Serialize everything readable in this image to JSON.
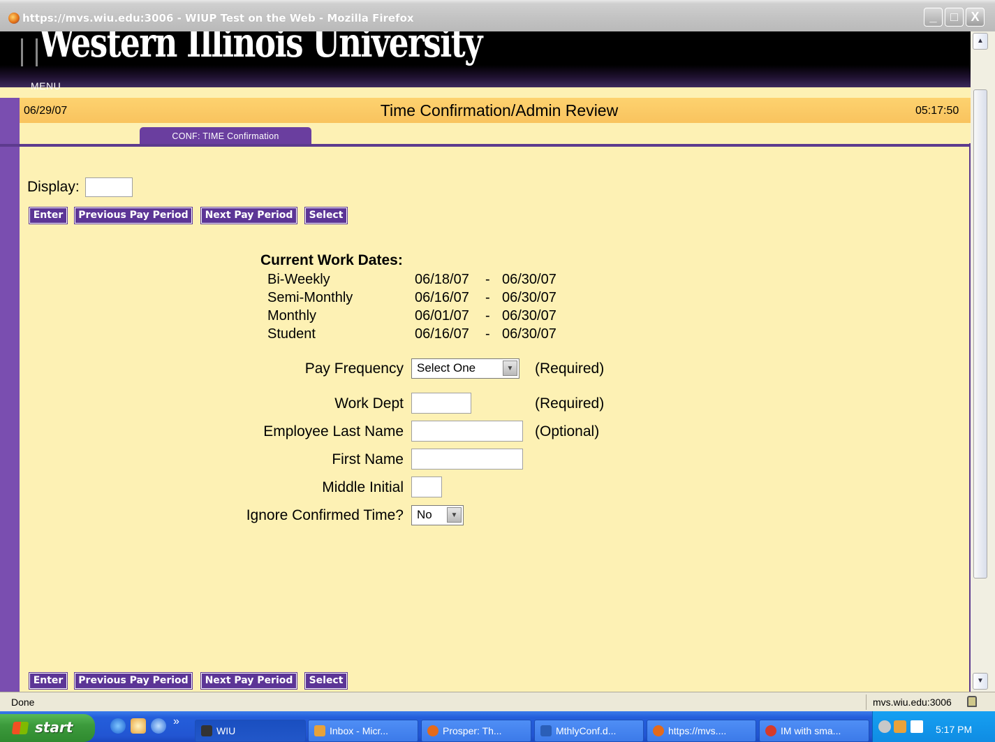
{
  "window": {
    "title": "https://mvs.wiu.edu:3006 - WIUP Test on the Web - Mozilla Firefox",
    "min_label": "_",
    "max_label": "□",
    "close_label": "X"
  },
  "header": {
    "logo_text": "Western Illinois University",
    "menu_label": "MENU",
    "date": "06/29/07",
    "title": "Time Confirmation/Admin Review",
    "time": "05:17:50",
    "tab_label": "CONF: TIME Confirmation"
  },
  "display": {
    "label": "Display:",
    "value": ""
  },
  "buttons": {
    "enter": "Enter",
    "previous": "Previous Pay Period",
    "next": "Next Pay Period",
    "select": "Select"
  },
  "current_work_dates": {
    "title": "Current Work Dates:",
    "rows": [
      {
        "name": "Bi-Weekly",
        "start": "06/18/07",
        "dash": "-",
        "end": "06/30/07"
      },
      {
        "name": "Semi-Monthly",
        "start": "06/16/07",
        "dash": "-",
        "end": "06/30/07"
      },
      {
        "name": "Monthly",
        "start": "06/01/07",
        "dash": "-",
        "end": "06/30/07"
      },
      {
        "name": "Student",
        "start": "06/16/07",
        "dash": "-",
        "end": "06/30/07"
      }
    ]
  },
  "form": {
    "pay_frequency": {
      "label": "Pay Frequency",
      "selected": "Select One",
      "note": "(Required)"
    },
    "work_dept": {
      "label": "Work Dept",
      "value": "",
      "note": "(Required)"
    },
    "last_name": {
      "label": "Employee Last Name",
      "value": "",
      "note": "(Optional)"
    },
    "first_name": {
      "label": "First Name",
      "value": ""
    },
    "middle_initial": {
      "label": "Middle Initial",
      "value": ""
    },
    "ignore_confirmed": {
      "label": "Ignore Confirmed Time?",
      "selected": "No"
    }
  },
  "status": {
    "text": "Done",
    "host": "mvs.wiu.edu:3006"
  },
  "taskbar": {
    "start_label": "start",
    "chevron": "»",
    "tasks": [
      {
        "label": "WIU",
        "color": "#333333"
      },
      {
        "label": "Inbox - Micr...",
        "color": "#e8a23a"
      },
      {
        "label": "Prosper: Th...",
        "color": "#e56a1a"
      },
      {
        "label": "MthlyConf.d...",
        "color": "#2b5fb8"
      },
      {
        "label": "https://mvs....",
        "color": "#e56a1a"
      },
      {
        "label": "IM with sma...",
        "color": "#d63a2a"
      }
    ],
    "clock": "5:17 PM"
  },
  "colors": {
    "page_bg": "#fdf1b4",
    "purple": "#5c3596",
    "gold": "#f9c35e"
  }
}
